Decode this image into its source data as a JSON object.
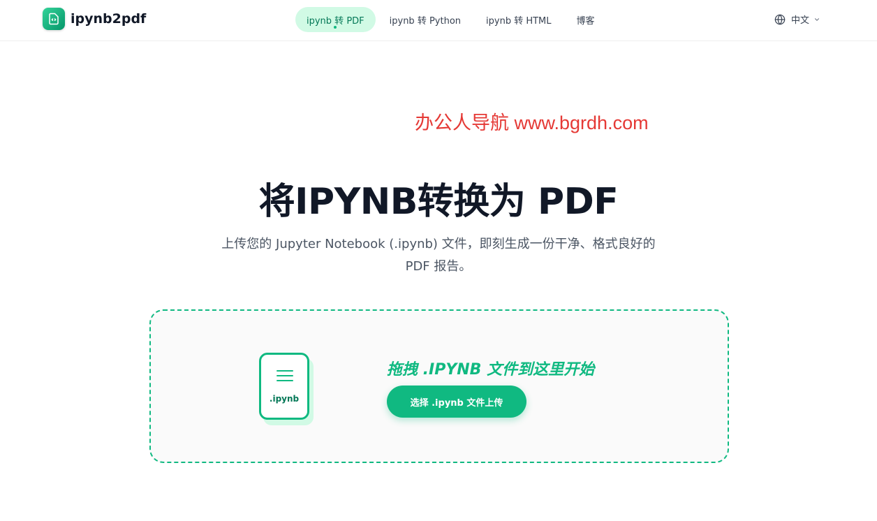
{
  "brand": {
    "name": "ipynb2pdf",
    "accent": "#10b981"
  },
  "nav": {
    "items": [
      {
        "label": "ipynb 转 PDF",
        "active": true
      },
      {
        "label": "ipynb 转 Python",
        "active": false
      },
      {
        "label": "ipynb 转 HTML",
        "active": false
      },
      {
        "label": "博客",
        "active": false
      }
    ]
  },
  "language": {
    "label": "中文",
    "icon": "globe-icon"
  },
  "watermark": "办公人导航  www.bgrdh.com",
  "hero": {
    "title": "将IPYNB转换为 PDF",
    "subtitle_line1": "上传您的 Jupyter Notebook (.ipynb) 文件，即刻生成一份干净、格式良好的",
    "subtitle_line2": "PDF 报告。"
  },
  "dropzone": {
    "file_ext": ".ipynb",
    "title": "拖拽 .IPYNB 文件到这里开始",
    "button_label": "选择 .ipynb 文件上传"
  }
}
